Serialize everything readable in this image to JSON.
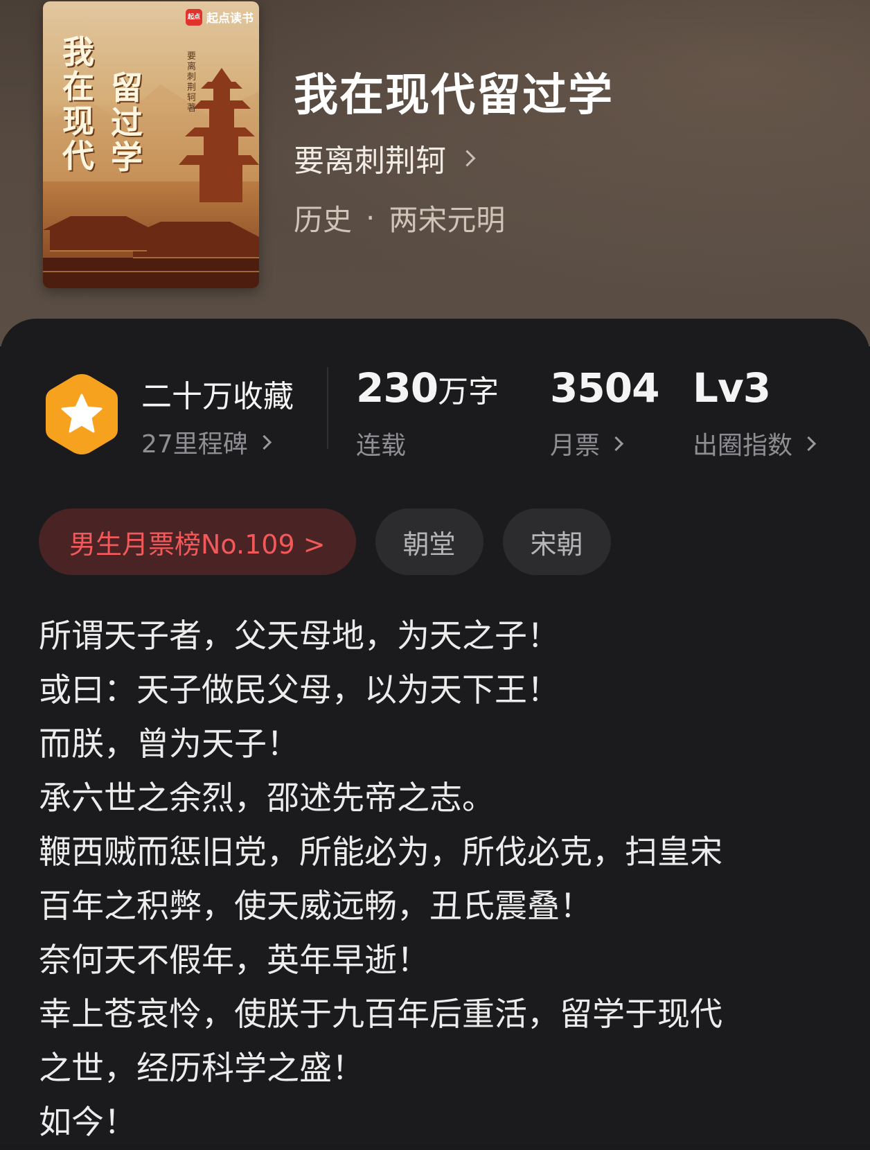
{
  "book": {
    "title": "我在现代留过学",
    "author": "要离刺荆轲",
    "genre": "历史",
    "subgenre": "两宋元明"
  },
  "cover": {
    "brand_logo_text": "起点",
    "brand_name": "起点读书",
    "title_col1": "我在现代",
    "title_col2": "留过学",
    "author_vertical": "要离刺荆轲著"
  },
  "stats": {
    "collection": "二十万收藏",
    "milestone": "27里程碑",
    "word_count_num": "230",
    "word_count_unit": "万字",
    "status": "连载",
    "monthly_votes": "3504",
    "monthly_votes_label": "月票",
    "level": "Lv3",
    "level_label": "出圈指数"
  },
  "tags": {
    "rank": "男生月票榜No.109 >",
    "tag1": "朝堂",
    "tag2": "宋朝"
  },
  "intro": [
    "所谓天子者，父天母地，为天之子！",
    "或曰：天子做民父母，以为天下王！",
    "而朕，曾为天子！",
    "承六世之余烈，邵述先帝之志。",
    "鞭西贼而惩旧党，所能必为，所伐必克，扫皇宋",
    "百年之积弊，使天威远畅，丑氏震叠！",
    "奈何天不假年，英年早逝！",
    "幸上苍哀怜，使朕于九百年后重活，留学于现代",
    "之世，经历科学之盛！",
    "如今！"
  ],
  "colors": {
    "badge_orange": "#f6a21e",
    "rank_red": "#f2595b",
    "panel_bg": "#1b1b1d"
  }
}
